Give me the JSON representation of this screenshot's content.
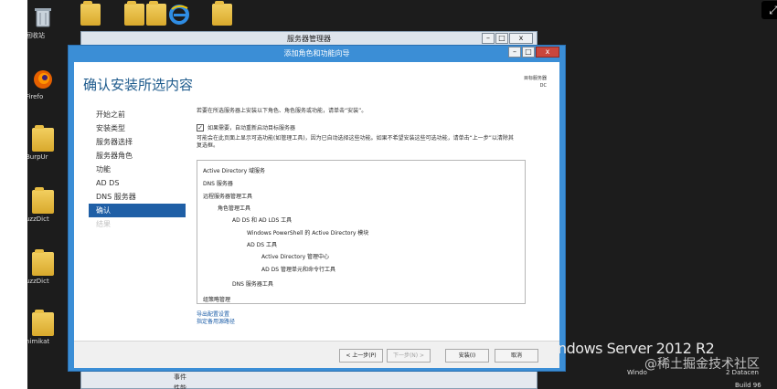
{
  "server_manager": {
    "title": "服务器管理器",
    "bottom_items": [
      "事件",
      "性能"
    ]
  },
  "desktop": {
    "icons": [
      {
        "label": "回收站",
        "icon": "recycle-bin-icon"
      },
      {
        "label": "Firefo",
        "icon": "firefox-icon"
      },
      {
        "label": "BurpUr",
        "icon": "folder-icon"
      },
      {
        "label": "uzzDict",
        "icon": "folder-icon"
      },
      {
        "label": "uzzDict",
        "icon": "folder-icon"
      },
      {
        "label": "nimikat",
        "icon": "folder-icon"
      }
    ],
    "top_icons": [
      "folder-icon",
      "folder-icon",
      "folder-icon",
      "ie-icon",
      "folder-icon"
    ],
    "brand_text": "ndows Server 2012 R2",
    "tray_text_1": "Windo",
    "tray_text_2": "2 Datacen",
    "tray_text_3": "Build 96",
    "watermark": "@稀土掘金技术社区"
  },
  "wizard": {
    "title": "添加角色和功能向导",
    "heading": "确认安装所选内容",
    "target_label": "目标服务器",
    "target_value": "DC",
    "nav": [
      {
        "label": "开始之前",
        "state": "normal"
      },
      {
        "label": "安装类型",
        "state": "normal"
      },
      {
        "label": "服务器选择",
        "state": "normal"
      },
      {
        "label": "服务器角色",
        "state": "normal"
      },
      {
        "label": "功能",
        "state": "normal"
      },
      {
        "label": "AD DS",
        "state": "normal"
      },
      {
        "label": "DNS 服务器",
        "state": "normal"
      },
      {
        "label": "确认",
        "state": "active"
      },
      {
        "label": "结果",
        "state": "disabled"
      }
    ],
    "intro": "若要在所选服务器上安装以下角色、角色服务或功能，请单击“安装”。",
    "checkbox_label": "如果需要，自动重新启动目标服务器",
    "checkbox_checked": true,
    "note": "可能会在此页面上显示可选功能(如管理工具)，因为已自动选择这些功能。如果不希望安装这些可选功能，请单击“上一步”以清除其复选框。",
    "list": [
      {
        "text": "Active Directory 域服务",
        "level": 0
      },
      {
        "text": "DNS 服务器",
        "level": 0
      },
      {
        "text": "远程服务器管理工具",
        "level": 0
      },
      {
        "text": "角色管理工具",
        "level": 1
      },
      {
        "text": "AD DS 和 AD LDS 工具",
        "level": 2
      },
      {
        "text": "Windows PowerShell 的 Active Directory 模块",
        "level": 3
      },
      {
        "text": "AD DS 工具",
        "level": 3
      },
      {
        "text": "Active Directory 管理中心",
        "level": 4
      },
      {
        "text": "AD DS 管理单元和命令行工具",
        "level": 4
      },
      {
        "text": "DNS 服务器工具",
        "level": 2
      },
      {
        "text": "组策略管理",
        "level": 0
      }
    ],
    "links": [
      "导出配置设置",
      "指定备用源路径"
    ],
    "buttons": {
      "previous": "< 上一步(P)",
      "next": "下一步(N) >",
      "install": "安装(I)",
      "cancel": "取消"
    }
  }
}
